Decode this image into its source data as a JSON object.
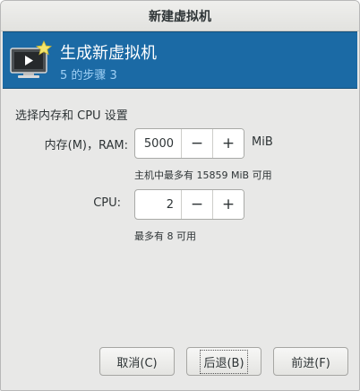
{
  "window": {
    "title": "新建虚拟机"
  },
  "header": {
    "title": "生成新虚拟机",
    "step": "5 的步骤 3",
    "icon": "vm-monitor-star-icon",
    "background_color": "#1b6aa5"
  },
  "section": {
    "title": "选择内存和 CPU 设置"
  },
  "memory": {
    "label": "内存(M)，RAM:",
    "value": "5000",
    "unit": "MiB",
    "hint": "主机中最多有 15859 MiB 可用",
    "decrement_label": "−",
    "increment_label": "+"
  },
  "cpu": {
    "label": "CPU:",
    "value": "2",
    "hint": "最多有 8 可用",
    "decrement_label": "−",
    "increment_label": "+"
  },
  "buttons": {
    "cancel": "取消(C)",
    "back": "后退(B)",
    "forward": "前进(F)"
  }
}
